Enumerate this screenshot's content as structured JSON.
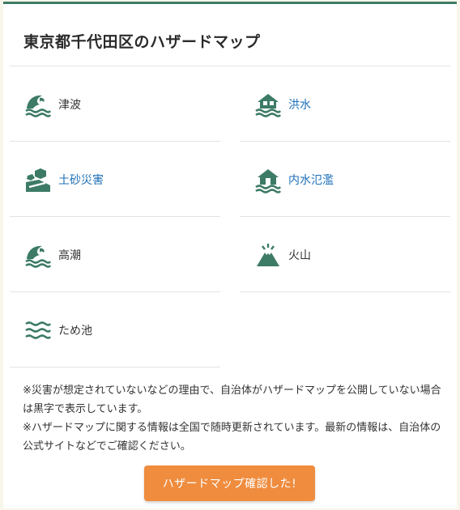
{
  "title": "東京都千代田区のハザードマップ",
  "accent_color": "#3d7b67",
  "link_color": "#1d6fb8",
  "hazards": [
    {
      "icon": "tsunami-icon",
      "label": "津波",
      "linked": false
    },
    {
      "icon": "flood-icon",
      "label": "洪水",
      "linked": true
    },
    {
      "icon": "landslide-icon",
      "label": "土砂災害",
      "linked": true
    },
    {
      "icon": "inland-flood-icon",
      "label": "内水氾濫",
      "linked": true
    },
    {
      "icon": "storm-surge-icon",
      "label": "高潮",
      "linked": false
    },
    {
      "icon": "volcano-icon",
      "label": "火山",
      "linked": false
    },
    {
      "icon": "reservoir-icon",
      "label": "ため池",
      "linked": false
    }
  ],
  "notes": [
    "※災害が想定されていないなどの理由で、自治体がハザードマップを公開していない場合は黒字で表示しています。",
    "※ハザードマップに関する情報は全国で随時更新されています。最新の情報は、自治体の公式サイトなどでご確認ください。"
  ],
  "confirm_button": "ハザードマップ確認した!"
}
